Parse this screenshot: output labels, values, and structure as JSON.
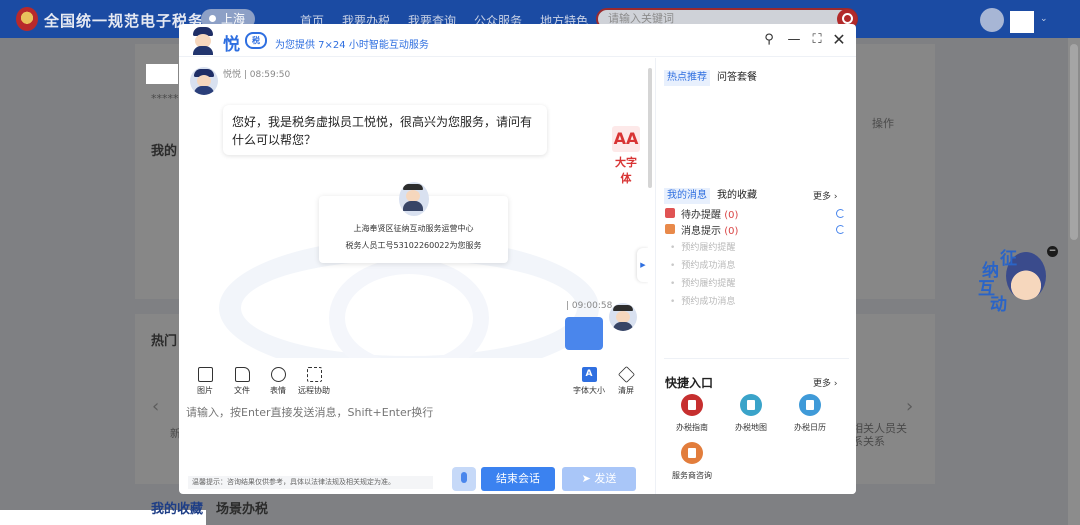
{
  "site": {
    "title": "全国统一规范电子税务局",
    "city": "上海",
    "nav": [
      "首页",
      "我要办税",
      "我要查询",
      "公众服务",
      "地方特色"
    ],
    "search_placeholder": "请输入关键词"
  },
  "background": {
    "my_label": "我的",
    "operation": "操作",
    "hot_label": "热门",
    "new_label": "新",
    "related_people": "相关人员关",
    "related_sys": "系关系",
    "favorites_tab": "我的收藏",
    "scene_tab": "场景办税",
    "masked_value": "**********"
  },
  "mascot": {
    "word1": "征",
    "word2": "纳",
    "word3": "互",
    "word4": "动"
  },
  "dialog": {
    "brand": "悦",
    "brand_badge": "税",
    "tagline": "为您提供 7×24 小时智能互动服务",
    "window_buttons": {
      "user": "user-icon",
      "minimize": "minimize-icon",
      "fullscreen": "fullscreen-icon",
      "close": "close-icon"
    }
  },
  "chat": {
    "bot_meta": "悦悦 | 08:59:50",
    "bot_message": "您好，我是税务虚拟员工悦悦，很高兴为您服务，请问有什么可以帮您？",
    "big_font_label": "大字体",
    "big_font_icon": "AA",
    "agent_card": {
      "line1": "上海奉贤区征纳互动服务运营中心",
      "line2": "税务人员工号53102260022为您服务"
    },
    "user_meta": "| 09:00:58"
  },
  "toolbar": {
    "image": "图片",
    "file": "文件",
    "emoji": "表情",
    "remote": "远程协助",
    "font_size": "字体大小",
    "clear": "清屏"
  },
  "input": {
    "placeholder": "请输入，按Enter直接发送消息，Shift+Enter换行",
    "tip": "温馨提示：咨询结果仅供参考，具体以法律法规及相关规定为准。",
    "end_session": "结束会话",
    "send": "➤ 发送"
  },
  "right_panel": {
    "tabs_top": {
      "hot": "热点推荐",
      "qa": "问答套餐"
    },
    "tabs_msg": {
      "my_messages": "我的消息",
      "my_favorites": "我的收藏",
      "more": "更多 ›"
    },
    "todo": {
      "label": "待办提醒",
      "count": "(0)"
    },
    "notice": {
      "label": "消息提示",
      "count": "(0)"
    },
    "sub_items": [
      "预约履约提醒",
      "预约成功消息",
      "预约履约提醒",
      "预约成功消息"
    ],
    "quick": {
      "title": "快捷入口",
      "more": "更多 ›",
      "items": [
        {
          "label": "办税指南",
          "color": "#c62f2f"
        },
        {
          "label": "办税地图",
          "color": "#3aa3c9"
        },
        {
          "label": "办税日历",
          "color": "#3f9ad8"
        },
        {
          "label": "服务商咨询",
          "color": "#e27d3c"
        }
      ]
    }
  },
  "colors": {
    "primary": "#2f6fe0",
    "header_bg": "#1b4ba3",
    "danger": "#d83434"
  }
}
